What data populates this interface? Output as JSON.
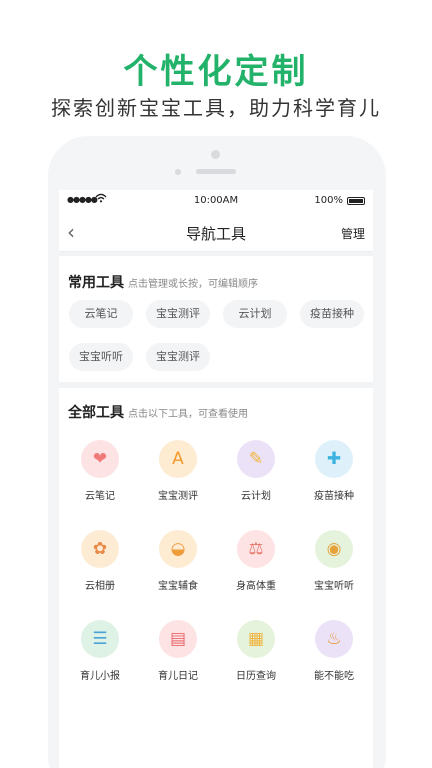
{
  "promo": {
    "title": "个性化定制",
    "subtitle": "探索创新宝宝工具，助力科学育儿"
  },
  "statusbar": {
    "signal": "●●●●●",
    "wifi": "wifi-icon",
    "time": "10:00AM",
    "battery": "100%"
  },
  "navbar": {
    "back_icon": "‹",
    "title": "导航工具",
    "manage": "管理"
  },
  "common_tools": {
    "title": "常用工具",
    "hint": "点击管理或长按，可编辑顺序",
    "items": [
      "云笔记",
      "宝宝测评",
      "云计划",
      "疫苗接种",
      "宝宝听听",
      "宝宝测评"
    ]
  },
  "all_tools": {
    "title": "全部工具",
    "hint": "点击以下工具，可查看使用",
    "items": [
      {
        "label": "云笔记",
        "icon": "cloud-notes-icon",
        "glyph": "❤",
        "bg": "#fde3e3",
        "fg": "#f07a7a"
      },
      {
        "label": "宝宝测评",
        "icon": "baby-assessment-icon",
        "glyph": "A",
        "bg": "#fdebd2",
        "fg": "#f29b2c"
      },
      {
        "label": "云计划",
        "icon": "cloud-plan-icon",
        "glyph": "✎",
        "bg": "#ebe2f7",
        "fg": "#f2b53a"
      },
      {
        "label": "疫苗接种",
        "icon": "vaccine-icon",
        "glyph": "✚",
        "bg": "#def1fa",
        "fg": "#3fb3e0"
      },
      {
        "label": "云相册",
        "icon": "cloud-album-icon",
        "glyph": "✿",
        "bg": "#fdecd3",
        "fg": "#e88a4a"
      },
      {
        "label": "宝宝辅食",
        "icon": "baby-food-icon",
        "glyph": "◒",
        "bg": "#fdebd2",
        "fg": "#ef9c3a"
      },
      {
        "label": "身高体重",
        "icon": "height-weight-icon",
        "glyph": "⚖",
        "bg": "#fde3e3",
        "fg": "#e8766a"
      },
      {
        "label": "宝宝听听",
        "icon": "radio-icon",
        "glyph": "◉",
        "bg": "#e6f3dc",
        "fg": "#e6a23a"
      },
      {
        "label": "育儿小报",
        "icon": "newspaper-icon",
        "glyph": "☰",
        "bg": "#dff2e6",
        "fg": "#4aa3d8"
      },
      {
        "label": "育儿日记",
        "icon": "diary-icon",
        "glyph": "▤",
        "bg": "#fde3e3",
        "fg": "#e8666a"
      },
      {
        "label": "日历查询",
        "icon": "calendar-icon",
        "glyph": "▦",
        "bg": "#e6f3dc",
        "fg": "#f0b13a"
      },
      {
        "label": "能不能吃",
        "icon": "can-eat-icon",
        "glyph": "♨",
        "bg": "#ebe2f7",
        "fg": "#e89a3a"
      }
    ]
  }
}
